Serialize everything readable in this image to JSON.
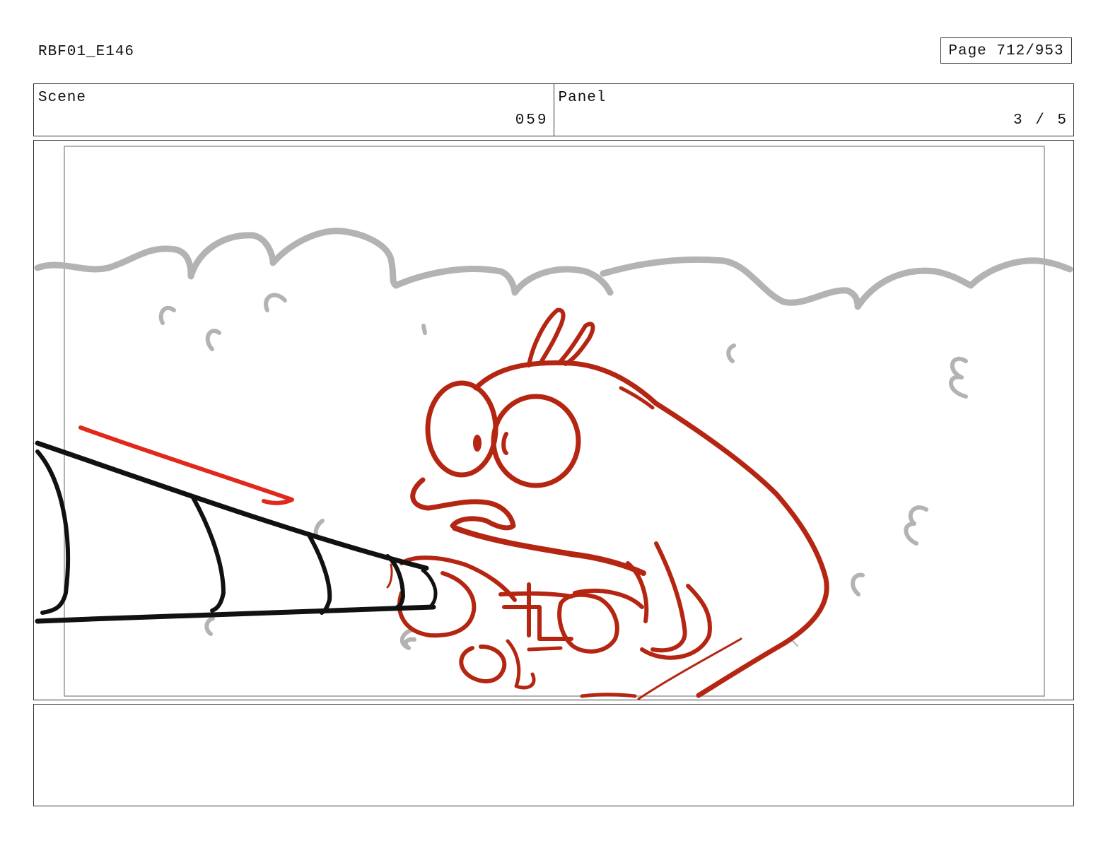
{
  "header": {
    "title": "RBF01_E146",
    "page_label": "Page 712/953"
  },
  "scene": {
    "label": "Scene",
    "value": "059"
  },
  "panel": {
    "label": "Panel",
    "value": "3 / 5"
  },
  "drawing": {
    "background_color": "#b3b3b3",
    "character_color": "#b52612",
    "accent_color": "#e0291b",
    "object_color": "#111111"
  },
  "notes": {
    "text": ""
  }
}
